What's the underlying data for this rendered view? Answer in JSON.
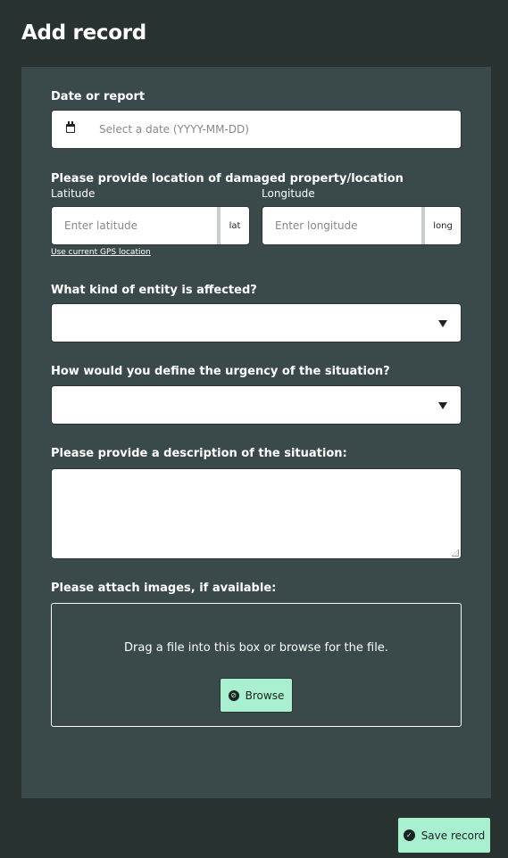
{
  "page": {
    "title": "Add record"
  },
  "date": {
    "label": "Date or report",
    "placeholder": "Select a date (YYYY-MM-DD)",
    "icon": "calendar-icon"
  },
  "location": {
    "label": "Please provide location of damaged property/location",
    "latitude": {
      "label": "Latitude",
      "placeholder": "Enter latitude",
      "addon": "lat"
    },
    "longitude": {
      "label": "Longitude",
      "placeholder": "Enter longitude",
      "addon": "long"
    },
    "gps_link": "Use current GPS location"
  },
  "entity": {
    "label": "What kind of entity is affected?",
    "value": ""
  },
  "urgency": {
    "label": "How would you define the urgency of the situation?",
    "value": ""
  },
  "description": {
    "label": "Please provide a description of the situation:",
    "value": ""
  },
  "attachments": {
    "label": "Please attach images, if available:",
    "drop_text": "Drag a file into this box or browse for the file.",
    "browse_label": "Browse",
    "browse_icon": "paperclip-icon"
  },
  "actions": {
    "save_label": "Save record",
    "save_icon": "check-circle-icon"
  },
  "colors": {
    "page_bg": "#283230",
    "card_bg": "#3a4a4a",
    "accent": "#a8f0cf"
  }
}
